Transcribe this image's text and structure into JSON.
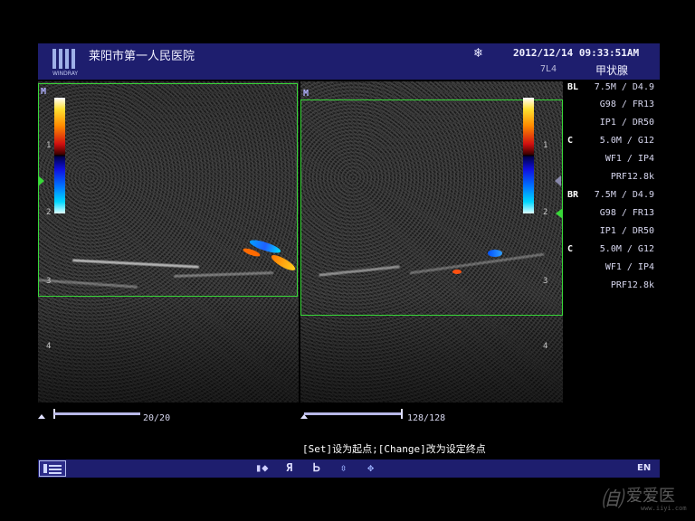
{
  "header": {
    "logo_text": "WINDRAY",
    "hospital_name": "莱阳市第一人民医院",
    "freeze_icon": "snowflake-icon",
    "datetime": "2012/12/14  09:33:51AM",
    "probe": "7L4",
    "exam_preset": "甲状腺"
  },
  "left_image": {
    "marker": "M",
    "depth_labels": [
      "1",
      "2",
      "3",
      "4"
    ]
  },
  "right_image": {
    "marker": "M",
    "depth_labels": [
      "1",
      "2",
      "3",
      "4"
    ]
  },
  "params": {
    "left": [
      {
        "tag": "BL",
        "value": "7.5M / D4.9"
      },
      {
        "tag": "",
        "value": "G98 / FR13"
      },
      {
        "tag": "",
        "value": "IP1 / DR50"
      },
      {
        "tag": "C",
        "value": "5.0M /  G12"
      },
      {
        "tag": "",
        "value": "WF1 /  IP4"
      },
      {
        "tag": "",
        "value": "PRF12.8k"
      }
    ],
    "right": [
      {
        "tag": "BR",
        "value": "7.5M / D4.9"
      },
      {
        "tag": "",
        "value": "G98 / FR13"
      },
      {
        "tag": "",
        "value": "IP1 / DR50"
      },
      {
        "tag": "C",
        "value": "5.0M /  G12"
      },
      {
        "tag": "",
        "value": "WF1 /  IP4"
      },
      {
        "tag": "",
        "value": "PRF12.8k"
      }
    ]
  },
  "cine": {
    "left": {
      "frame": "20/20",
      "position": 1.0
    },
    "right": {
      "frame": "128/128",
      "position": 1.0
    }
  },
  "hint": "[Set]设为起点;[Change]改为设定终点",
  "bottom_bar": {
    "menu_icon": "screen-layout-icon",
    "tools": [
      {
        "icon": "body-mark-icon",
        "glyph": "▮◆"
      },
      {
        "icon": "flip-vertical-icon",
        "glyph": "Я"
      },
      {
        "icon": "flip-horizontal-icon",
        "glyph": "Ꮟ"
      },
      {
        "icon": "up-down-arrows-icon",
        "glyph": "⇳"
      },
      {
        "icon": "four-arrows-icon",
        "glyph": "✥"
      }
    ],
    "language": "EN"
  },
  "watermark": {
    "text": "爱爱医",
    "url": "www.iiyi.com"
  },
  "colors": {
    "header_bg": "#1e1e6e",
    "roi_green": "#38d838"
  }
}
